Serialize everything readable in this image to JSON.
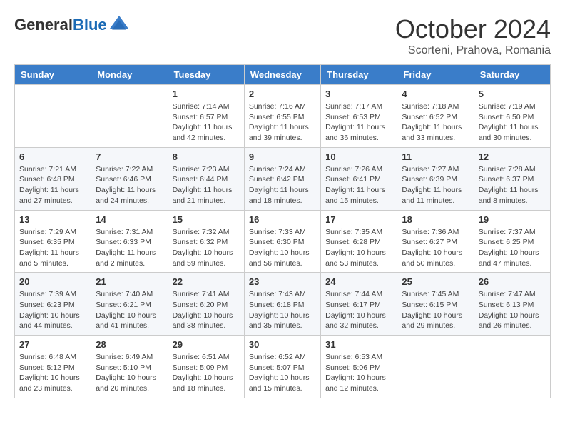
{
  "header": {
    "logo_general": "General",
    "logo_blue": "Blue",
    "month_title": "October 2024",
    "location": "Scorteni, Prahova, Romania"
  },
  "weekdays": [
    "Sunday",
    "Monday",
    "Tuesday",
    "Wednesday",
    "Thursday",
    "Friday",
    "Saturday"
  ],
  "weeks": [
    [
      {
        "day": "",
        "sunrise": "",
        "sunset": "",
        "daylight": ""
      },
      {
        "day": "",
        "sunrise": "",
        "sunset": "",
        "daylight": ""
      },
      {
        "day": "1",
        "sunrise": "Sunrise: 7:14 AM",
        "sunset": "Sunset: 6:57 PM",
        "daylight": "Daylight: 11 hours and 42 minutes."
      },
      {
        "day": "2",
        "sunrise": "Sunrise: 7:16 AM",
        "sunset": "Sunset: 6:55 PM",
        "daylight": "Daylight: 11 hours and 39 minutes."
      },
      {
        "day": "3",
        "sunrise": "Sunrise: 7:17 AM",
        "sunset": "Sunset: 6:53 PM",
        "daylight": "Daylight: 11 hours and 36 minutes."
      },
      {
        "day": "4",
        "sunrise": "Sunrise: 7:18 AM",
        "sunset": "Sunset: 6:52 PM",
        "daylight": "Daylight: 11 hours and 33 minutes."
      },
      {
        "day": "5",
        "sunrise": "Sunrise: 7:19 AM",
        "sunset": "Sunset: 6:50 PM",
        "daylight": "Daylight: 11 hours and 30 minutes."
      }
    ],
    [
      {
        "day": "6",
        "sunrise": "Sunrise: 7:21 AM",
        "sunset": "Sunset: 6:48 PM",
        "daylight": "Daylight: 11 hours and 27 minutes."
      },
      {
        "day": "7",
        "sunrise": "Sunrise: 7:22 AM",
        "sunset": "Sunset: 6:46 PM",
        "daylight": "Daylight: 11 hours and 24 minutes."
      },
      {
        "day": "8",
        "sunrise": "Sunrise: 7:23 AM",
        "sunset": "Sunset: 6:44 PM",
        "daylight": "Daylight: 11 hours and 21 minutes."
      },
      {
        "day": "9",
        "sunrise": "Sunrise: 7:24 AM",
        "sunset": "Sunset: 6:42 PM",
        "daylight": "Daylight: 11 hours and 18 minutes."
      },
      {
        "day": "10",
        "sunrise": "Sunrise: 7:26 AM",
        "sunset": "Sunset: 6:41 PM",
        "daylight": "Daylight: 11 hours and 15 minutes."
      },
      {
        "day": "11",
        "sunrise": "Sunrise: 7:27 AM",
        "sunset": "Sunset: 6:39 PM",
        "daylight": "Daylight: 11 hours and 11 minutes."
      },
      {
        "day": "12",
        "sunrise": "Sunrise: 7:28 AM",
        "sunset": "Sunset: 6:37 PM",
        "daylight": "Daylight: 11 hours and 8 minutes."
      }
    ],
    [
      {
        "day": "13",
        "sunrise": "Sunrise: 7:29 AM",
        "sunset": "Sunset: 6:35 PM",
        "daylight": "Daylight: 11 hours and 5 minutes."
      },
      {
        "day": "14",
        "sunrise": "Sunrise: 7:31 AM",
        "sunset": "Sunset: 6:33 PM",
        "daylight": "Daylight: 11 hours and 2 minutes."
      },
      {
        "day": "15",
        "sunrise": "Sunrise: 7:32 AM",
        "sunset": "Sunset: 6:32 PM",
        "daylight": "Daylight: 10 hours and 59 minutes."
      },
      {
        "day": "16",
        "sunrise": "Sunrise: 7:33 AM",
        "sunset": "Sunset: 6:30 PM",
        "daylight": "Daylight: 10 hours and 56 minutes."
      },
      {
        "day": "17",
        "sunrise": "Sunrise: 7:35 AM",
        "sunset": "Sunset: 6:28 PM",
        "daylight": "Daylight: 10 hours and 53 minutes."
      },
      {
        "day": "18",
        "sunrise": "Sunrise: 7:36 AM",
        "sunset": "Sunset: 6:27 PM",
        "daylight": "Daylight: 10 hours and 50 minutes."
      },
      {
        "day": "19",
        "sunrise": "Sunrise: 7:37 AM",
        "sunset": "Sunset: 6:25 PM",
        "daylight": "Daylight: 10 hours and 47 minutes."
      }
    ],
    [
      {
        "day": "20",
        "sunrise": "Sunrise: 7:39 AM",
        "sunset": "Sunset: 6:23 PM",
        "daylight": "Daylight: 10 hours and 44 minutes."
      },
      {
        "day": "21",
        "sunrise": "Sunrise: 7:40 AM",
        "sunset": "Sunset: 6:21 PM",
        "daylight": "Daylight: 10 hours and 41 minutes."
      },
      {
        "day": "22",
        "sunrise": "Sunrise: 7:41 AM",
        "sunset": "Sunset: 6:20 PM",
        "daylight": "Daylight: 10 hours and 38 minutes."
      },
      {
        "day": "23",
        "sunrise": "Sunrise: 7:43 AM",
        "sunset": "Sunset: 6:18 PM",
        "daylight": "Daylight: 10 hours and 35 minutes."
      },
      {
        "day": "24",
        "sunrise": "Sunrise: 7:44 AM",
        "sunset": "Sunset: 6:17 PM",
        "daylight": "Daylight: 10 hours and 32 minutes."
      },
      {
        "day": "25",
        "sunrise": "Sunrise: 7:45 AM",
        "sunset": "Sunset: 6:15 PM",
        "daylight": "Daylight: 10 hours and 29 minutes."
      },
      {
        "day": "26",
        "sunrise": "Sunrise: 7:47 AM",
        "sunset": "Sunset: 6:13 PM",
        "daylight": "Daylight: 10 hours and 26 minutes."
      }
    ],
    [
      {
        "day": "27",
        "sunrise": "Sunrise: 6:48 AM",
        "sunset": "Sunset: 5:12 PM",
        "daylight": "Daylight: 10 hours and 23 minutes."
      },
      {
        "day": "28",
        "sunrise": "Sunrise: 6:49 AM",
        "sunset": "Sunset: 5:10 PM",
        "daylight": "Daylight: 10 hours and 20 minutes."
      },
      {
        "day": "29",
        "sunrise": "Sunrise: 6:51 AM",
        "sunset": "Sunset: 5:09 PM",
        "daylight": "Daylight: 10 hours and 18 minutes."
      },
      {
        "day": "30",
        "sunrise": "Sunrise: 6:52 AM",
        "sunset": "Sunset: 5:07 PM",
        "daylight": "Daylight: 10 hours and 15 minutes."
      },
      {
        "day": "31",
        "sunrise": "Sunrise: 6:53 AM",
        "sunset": "Sunset: 5:06 PM",
        "daylight": "Daylight: 10 hours and 12 minutes."
      },
      {
        "day": "",
        "sunrise": "",
        "sunset": "",
        "daylight": ""
      },
      {
        "day": "",
        "sunrise": "",
        "sunset": "",
        "daylight": ""
      }
    ]
  ]
}
